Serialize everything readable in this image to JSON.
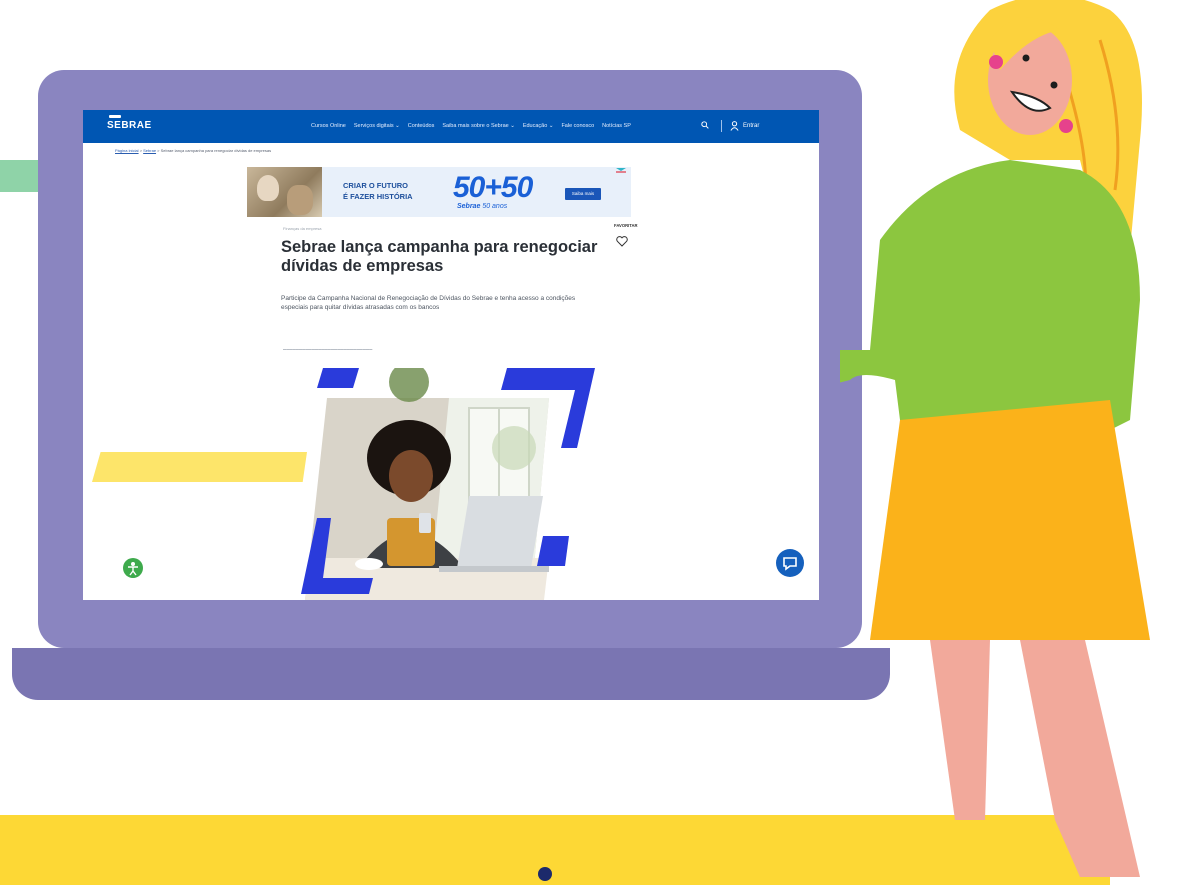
{
  "colors": {
    "laptop": "#8a85c0",
    "header": "#0056b3",
    "accent_blue": "#1a60d6",
    "bottom_bar": "#fdd835"
  },
  "site": {
    "logo": "SEBRAE",
    "nav": [
      "Cursos Online",
      "Serviços digitais ⌄",
      "Conteúdos",
      "Saiba mais sobre o Sebrae ⌄",
      "Educação ⌄",
      "Fale conosco",
      "Notícias SP"
    ],
    "login": "Entrar",
    "icons": {
      "search": "search-icon",
      "user": "user-icon"
    }
  },
  "breadcrumb": {
    "home": "Página inicial",
    "section": "Sebrae",
    "current": "Sebrae lança campanha para renegociar dívidas de empresas"
  },
  "banner": {
    "line1": "CRIAR O FUTURO",
    "line2": "É FAZER HISTÓRIA",
    "big": "50+50",
    "sub_brand": "Sebrae",
    "sub_years": "50 anos",
    "button": "Saiba mais"
  },
  "article": {
    "category": "Finanças da empresa",
    "title": "Sebrae lança campanha para renegociar dívidas de empresas",
    "lead": "Participe da Campanha Nacional de Renegociação de Dívidas do Sebrae e tenha acesso a condições especiais para quitar dívidas atrasadas com os bancos",
    "favorite": "FAVORITAR"
  }
}
